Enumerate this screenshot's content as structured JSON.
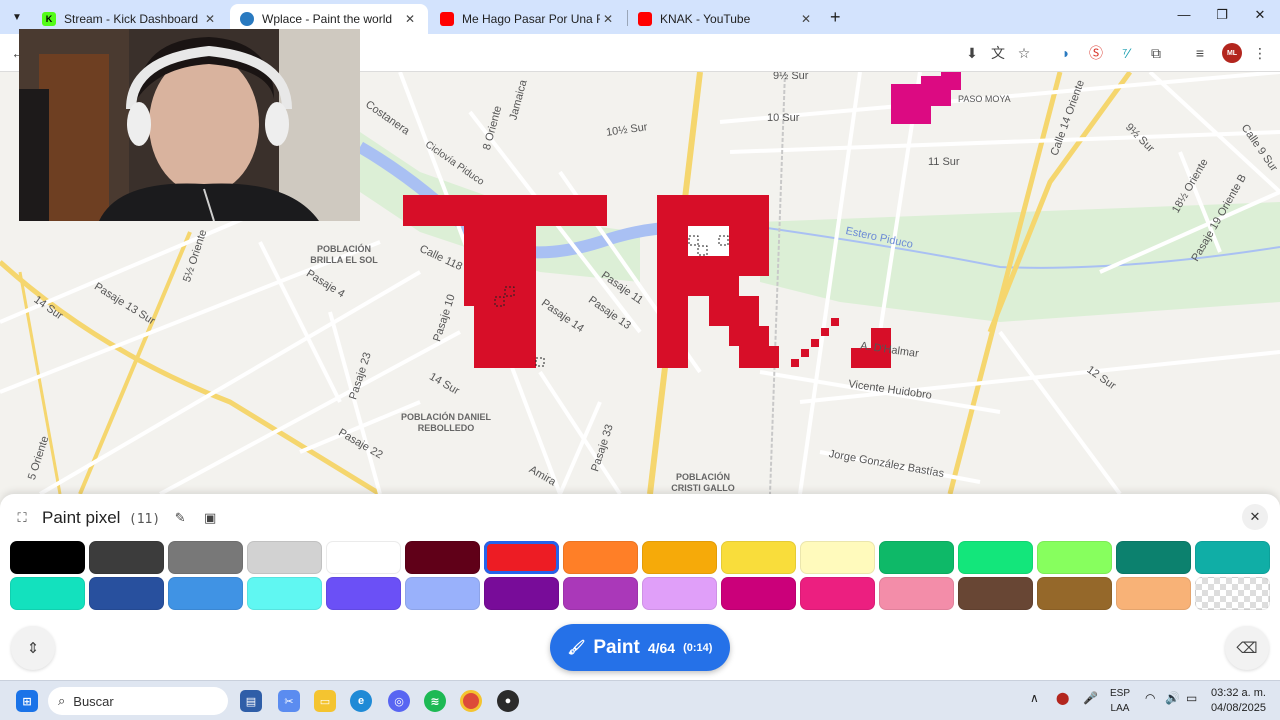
{
  "browser": {
    "tabs": [
      {
        "label": "Stream - Kick Dashboard",
        "favicon": "K",
        "favicon_color": "#53fc18",
        "active": false
      },
      {
        "label": "Wplace - Paint the world",
        "favicon": "",
        "favicon_color": "#2a7ac0",
        "active": true
      },
      {
        "label": "Me Hago Pasar Por Una Figura",
        "favicon": "",
        "favicon_color": "#ff0000",
        "active": false
      },
      {
        "label": "KNAK - YouTube",
        "favicon": "",
        "favicon_color": "#ff0000",
        "active": false
      }
    ],
    "close_glyph": "✕",
    "new_tab_glyph": "+",
    "profile_label": "ML"
  },
  "map": {
    "labels": {
      "nine_half_sur": "9½ Sur",
      "ten_sur": "10 Sur",
      "ten_half_sur": "10½ Sur",
      "eleven_sur": "11 Sur",
      "twelve_sur": "12 Sur",
      "fourteen_sur": "14 Sur",
      "fourteen_sur_left": "14 Sur",
      "nine_half_sur_right": "9½ Sur",
      "paso_moya": "PASO MOYA",
      "costanera": "Costanera",
      "ocho_oriente": "8 Oriente",
      "jamaica": "Jamaica",
      "ciclovia": "Ciclovía Piduco",
      "estero": "Estero Piduco",
      "calle118": "Calle 118",
      "pasaje4": "Pasaje 4",
      "pasaje13sur": "Pasaje 13 Sur",
      "cinco_half_oriente": "5½ Oriente",
      "pasaje10": "Pasaje 10",
      "pasaje14": "Pasaje 14",
      "pasaje11": "Pasaje 11",
      "pasaje13": "Pasaje 13",
      "pasaje23": "Pasaje 23",
      "pasaje22": "Pasaje 22",
      "pasaje33": "Pasaje 33",
      "amira": "Amira",
      "calle14oriente": "Calle 14 Oriente",
      "calle9sur": "Calle 9 Sur",
      "dieciocho_half_oriente": "18½ Oriente",
      "pasaje19oriente": "Pasaje 19 Oriente B",
      "dhalmar": "A. D'Halmar",
      "huidobro": "Vicente Huidobro",
      "gonzalez": "Jorge González Bastías",
      "cinco_oriente": "5 Oriente",
      "brilla": "POBLACIÓN BRILLA EL SOL",
      "daniel": "POBLACIÓN DANIEL REBOLLEDO",
      "cristi": "POBLACIÓN CRISTI GALLO"
    },
    "paint_color": "#d70e28",
    "magenta_color": "#dc0a82"
  },
  "paint_panel": {
    "title": "Paint pixel",
    "count": "(11)",
    "close_glyph": "✕",
    "button_label": "Paint",
    "button_charges": "4/64",
    "button_timer": "(0:14)",
    "selected_color": "#d70e28",
    "palette_row1": [
      "#000000",
      "#3c3c3c",
      "#787878",
      "#d2d2d2",
      "#ffffff",
      "#600018",
      "#ed1c24",
      "#ff7f27",
      "#f6aa09",
      "#f9dd3b",
      "#fffabc",
      "#0eb968",
      "#13e67b",
      "#87ff5e",
      "#0c816e",
      "#10aea6"
    ],
    "palette_row2": [
      "#13e1be",
      "#28509e",
      "#4093e4",
      "#60f7f2",
      "#6b50f6",
      "#99b1fb",
      "#780c99",
      "#aa38b9",
      "#e09ff9",
      "#cb007a",
      "#ec1f80",
      "#f38da9",
      "#684634",
      "#95682a",
      "#f8b277",
      "transparent"
    ]
  },
  "taskbar": {
    "search_placeholder": "Buscar",
    "lang_top": "ESP",
    "lang_bottom": "LAA",
    "time": "03:32 a. m.",
    "date": "04/08/2025"
  }
}
